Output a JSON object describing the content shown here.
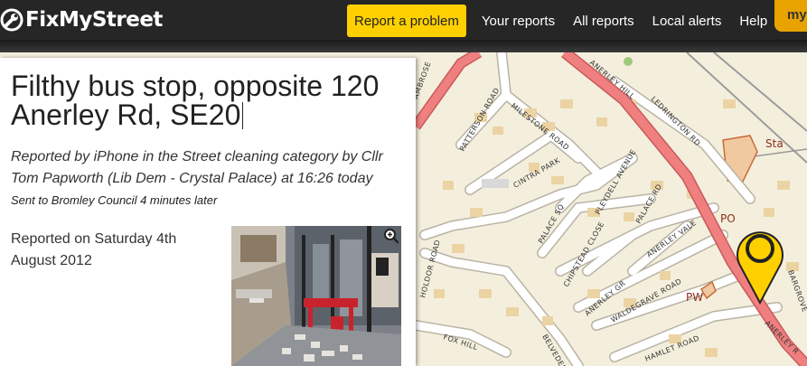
{
  "header": {
    "logo_text_fix": "Fix",
    "logo_text_my": "My",
    "logo_text_street": "Street",
    "nav": [
      "Report a problem",
      "Your reports",
      "All reports",
      "Local alerts",
      "Help"
    ],
    "my_tab": "my"
  },
  "report": {
    "title": "Filthy bus stop, opposite 120 Anerley Rd, SE20",
    "meta": "Reported by iPhone in the Street cleaning category by Cllr Tom Papworth (Lib Dem - Crystal Palace) at 16:26 today",
    "sent": "Sent to Bromley Council 4 minutes later",
    "reported_on": "Reported on Saturday 4th August 2012"
  },
  "map": {
    "streets": [
      "ANERLEY HILL",
      "MILESTONE ROAD",
      "PATTERSON ROAD",
      "LEDRINGTON RD",
      "CINTRA PARK",
      "PLEYDELL AVENUE",
      "PALACE RD",
      "PALACE SQ",
      "ANERLEY VALE",
      "CHIPSTEAD CLOSE",
      "ANERLEY GR",
      "WALDEGRAVE ROAD",
      "BELVEDERE",
      "FOX HILL",
      "HAMLET ROAD",
      "ANERLEY R",
      "HOLDOR ROAD",
      "AMBROSE",
      "BARGROVE"
    ],
    "pois": [
      "Sta",
      "PO",
      "PW"
    ]
  },
  "colors": {
    "header_bg": "#262626",
    "primary_button": "#ffd000",
    "my_tab": "#e8a300",
    "marker": "#ffd000",
    "main_road": "#f08080"
  },
  "icons": {
    "logo": "wrench-icon",
    "zoom": "magnifier-plus-icon",
    "marker": "map-pin-icon"
  }
}
